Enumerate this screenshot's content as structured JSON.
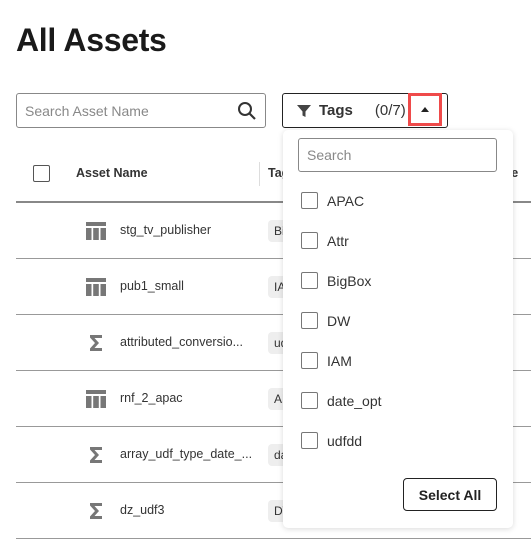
{
  "page": {
    "title": "All Assets"
  },
  "search": {
    "placeholder": "Search Asset Name"
  },
  "tags_filter": {
    "label": "Tags",
    "count": "(0/7)"
  },
  "table": {
    "columns": [
      "Asset Name",
      "Tags",
      "Type"
    ],
    "rows": [
      {
        "name": "stg_tv_publisher",
        "icon": "table-icon",
        "tag": "BigBox"
      },
      {
        "name": "pub1_small",
        "icon": "table-icon",
        "tag": "IAM"
      },
      {
        "name": "attributed_conversio...",
        "icon": "sigma-icon",
        "tag": "udfdd"
      },
      {
        "name": "rnf_2_apac",
        "icon": "table-icon",
        "tag": "APAC"
      },
      {
        "name": "array_udf_type_date_...",
        "icon": "sigma-icon",
        "tag": "date_opt"
      },
      {
        "name": "dz_udf3",
        "icon": "sigma-icon",
        "tag": "DW"
      }
    ]
  },
  "dropdown": {
    "search_placeholder": "Search",
    "options": [
      "APAC",
      "Attr",
      "BigBox",
      "DW",
      "IAM",
      "date_opt",
      "udfdd"
    ],
    "select_all": "Select All"
  },
  "colors": {
    "highlight": "#ef4a4a"
  }
}
